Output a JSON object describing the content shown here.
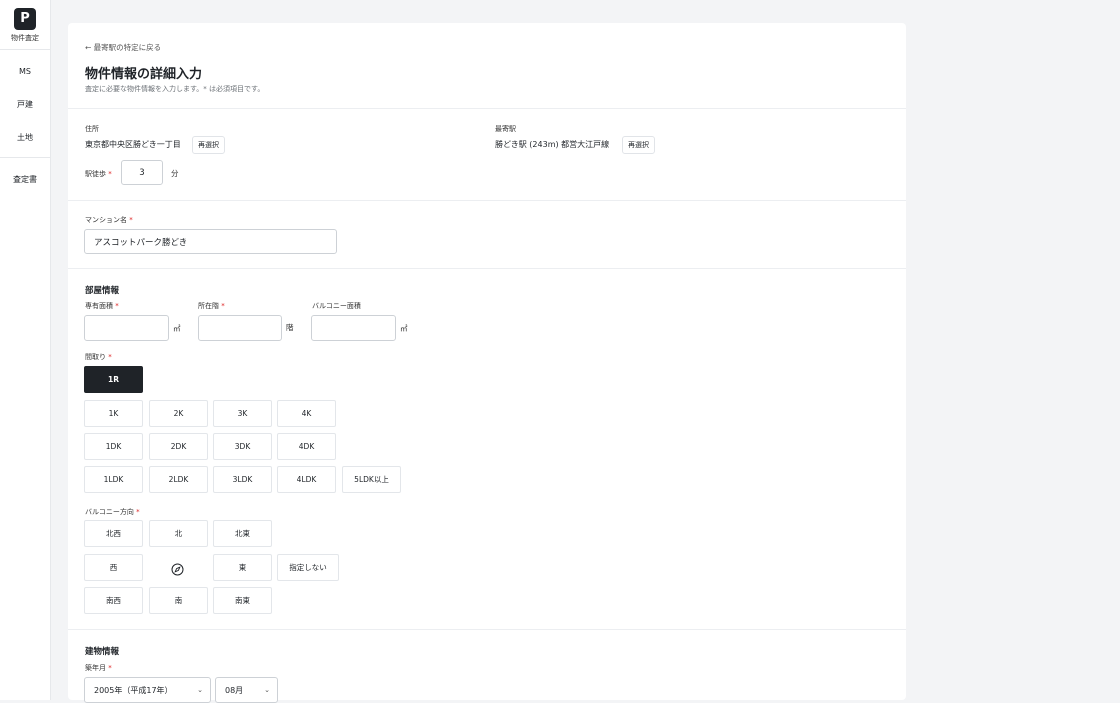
{
  "sidebar": {
    "logo_letter": "P",
    "logo_caption": "物件査定",
    "items": [
      {
        "label": "MS"
      },
      {
        "label": "戸建"
      },
      {
        "label": "土地"
      },
      {
        "label": "査定書"
      }
    ]
  },
  "header": {
    "back_link": "← 最寄駅の特定に戻る",
    "title": "物件情報の詳細入力",
    "subtitle": "査定に必要な物件情報を入力します。* は必須項目です。"
  },
  "location": {
    "address_label": "住所",
    "address_value": "東京都中央区勝どき一丁目",
    "address_reselect": "再選択",
    "station_label": "最寄駅",
    "station_value": "勝どき駅 (243m) 都営大江戸線",
    "station_reselect": "再選択",
    "walk_label": "駅徒歩",
    "walk_value": "3",
    "walk_unit": "分",
    "required_mark": "*"
  },
  "mansion": {
    "label": "マンション名",
    "value": "アスコットパーク勝どき",
    "required_mark": "*"
  },
  "room": {
    "section_title": "部屋情報",
    "area_label": "専有面積",
    "area_value": "",
    "area_unit": "㎡",
    "floor_label": "所在階",
    "floor_value": "",
    "floor_unit": "階",
    "balcony_area_label": "バルコニー面積",
    "balcony_area_value": "",
    "balcony_area_unit": "㎡",
    "required_mark": "*",
    "layout_label": "間取り",
    "layout_options": {
      "row0": [
        "1R"
      ],
      "row1": [
        "1K",
        "2K",
        "3K",
        "4K"
      ],
      "row2": [
        "1DK",
        "2DK",
        "3DK",
        "4DK"
      ],
      "row3": [
        "1LDK",
        "2LDK",
        "3LDK",
        "4LDK",
        "5LDK以上"
      ]
    },
    "layout_selected": "1R",
    "direction_label": "バルコニー方向",
    "directions": {
      "nw": "北西",
      "n": "北",
      "ne": "北東",
      "w": "西",
      "compass_icon": "compass-icon",
      "e": "東",
      "none": "指定しない",
      "sw": "南西",
      "s": "南",
      "se": "南東"
    }
  },
  "building": {
    "section_title": "建物情報",
    "built_label": "築年月",
    "year_value": "2005年（平成17年）",
    "month_value": "08月",
    "required_mark": "*"
  },
  "colors": {
    "accent_dark": "#1f2328",
    "required": "#dd2222",
    "background": "#f3f4f6"
  }
}
